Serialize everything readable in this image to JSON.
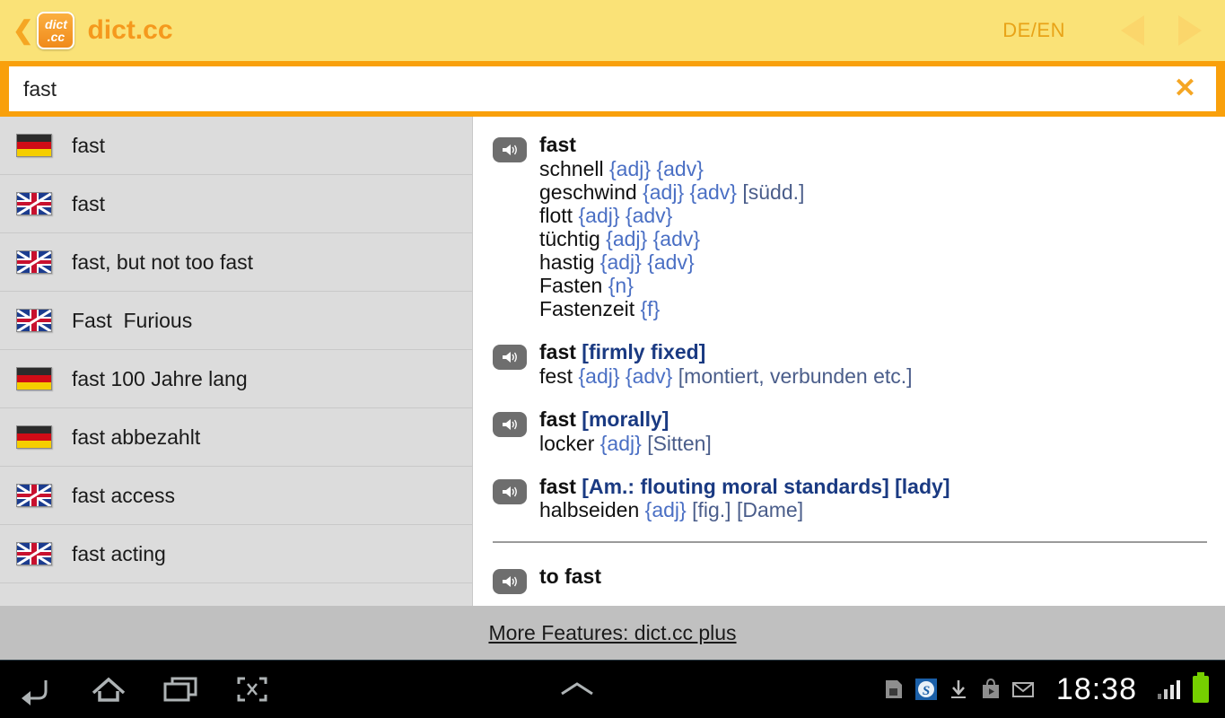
{
  "header": {
    "back_icon": "chevron-left-icon",
    "logo_line1": "dict",
    "logo_line2": ".cc",
    "app_title": "dict.cc",
    "language_pair": "DE/EN",
    "prev_icon": "triangle-left-icon",
    "next_icon": "triangle-right-icon"
  },
  "search": {
    "value": "fast",
    "placeholder": "",
    "clear_label": "✕"
  },
  "suggestions": [
    {
      "flag": "de",
      "label": "fast"
    },
    {
      "flag": "gb",
      "label": "fast"
    },
    {
      "flag": "gb",
      "label": "fast, but not too fast"
    },
    {
      "flag": "gb",
      "label": "Fast  Furious"
    },
    {
      "flag": "de",
      "label": "fast 100 Jahre lang"
    },
    {
      "flag": "de",
      "label": "fast abbezahlt"
    },
    {
      "flag": "gb",
      "label": "fast access"
    },
    {
      "flag": "gb",
      "label": "fast acting"
    }
  ],
  "entries": [
    {
      "speaker": "speaker-icon",
      "headword": "fast",
      "headword_note": "",
      "translations": [
        {
          "word": "schnell",
          "tags": "{adj} {adv}",
          "note": ""
        },
        {
          "word": "geschwind",
          "tags": "{adj} {adv}",
          "note": "[südd.]"
        },
        {
          "word": "flott",
          "tags": "{adj} {adv}",
          "note": ""
        },
        {
          "word": "tüchtig",
          "tags": "{adj} {adv}",
          "note": ""
        },
        {
          "word": "hastig",
          "tags": "{adj} {adv}",
          "note": ""
        },
        {
          "word": "Fasten",
          "tags": "{n}",
          "note": ""
        },
        {
          "word": "Fastenzeit",
          "tags": "{f}",
          "note": ""
        }
      ]
    },
    {
      "speaker": "speaker-icon",
      "headword": "fast",
      "headword_note": "[firmly fixed]",
      "translations": [
        {
          "word": "fest",
          "tags": "{adj} {adv}",
          "note": "[montiert, verbunden etc.]"
        }
      ]
    },
    {
      "speaker": "speaker-icon",
      "headword": "fast",
      "headword_note": "[morally]",
      "translations": [
        {
          "word": "locker",
          "tags": "{adj}",
          "note": "[Sitten]"
        }
      ]
    },
    {
      "speaker": "speaker-icon",
      "headword": "fast",
      "headword_note": "[Am.: flouting moral standards] [lady]",
      "translations": [
        {
          "word": "halbseiden",
          "tags": "{adj}",
          "note": "[fig.] [Dame]"
        }
      ]
    }
  ],
  "verb_entry": {
    "speaker": "speaker-icon",
    "headword": "to fast",
    "headword_note": ""
  },
  "footer": {
    "link_label": "More Features: dict.cc plus"
  },
  "navbar": {
    "back_icon": "back-arrow-icon",
    "home_icon": "home-icon",
    "recents_icon": "recent-apps-icon",
    "screenshot_icon": "screen-capture-icon",
    "up_icon": "chevron-up-icon",
    "status_icons": [
      "sim-card-icon",
      "skype-icon",
      "download-icon",
      "play-store-icon",
      "gmail-icon"
    ],
    "clock": "18:38",
    "signal_icon": "signal-bars-icon",
    "battery_icon": "battery-full-icon"
  },
  "colors": {
    "header_yellow": "#fae277",
    "accent_orange": "#f9a00b",
    "logo_orange": "#f5991d",
    "sidebar_gray": "#dcdcdc",
    "footer_gray": "#c0c0c0",
    "tag_blue": "#4a6fc4",
    "note_blue": "#1a3a82"
  }
}
